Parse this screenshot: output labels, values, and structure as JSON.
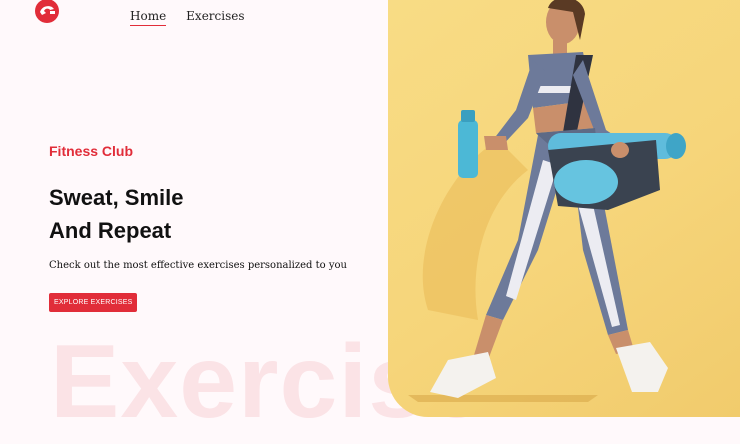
{
  "nav": {
    "items": [
      {
        "label": "Home",
        "active": true
      },
      {
        "label": "Exercises",
        "active": false
      }
    ]
  },
  "hero": {
    "eyebrow": "Fitness Club",
    "headline_line1": "Sweat, Smile",
    "headline_line2": "And Repeat",
    "subtitle": "Check out the most effective exercises personalized to you",
    "cta_label": "EXPLORE EXERCISES"
  },
  "background_word": "Exercise",
  "colors": {
    "accent": "#e12d39",
    "background": "#fff9fb",
    "image_bg": "#f6d57a",
    "watermark": "#fbe3e6"
  }
}
